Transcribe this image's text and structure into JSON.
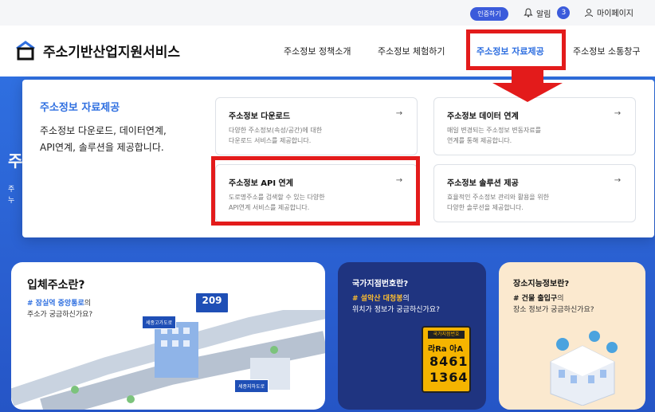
{
  "topbar": {
    "cert_label": "인증하기",
    "alarm_label": "알림",
    "alarm_count": "3",
    "mypage_label": "마이페이지"
  },
  "header": {
    "logo_title": "주소기반산업지원서비스",
    "nav": [
      {
        "label": "주소정보 정책소개"
      },
      {
        "label": "주소정보 체험하기"
      },
      {
        "label": "주소정보 자료제공"
      },
      {
        "label": "주소정보 소통창구"
      }
    ]
  },
  "hero": {
    "side_char": "주",
    "side_line1": "주",
    "side_line2": "누"
  },
  "panel": {
    "title": "주소정보 자료제공",
    "desc_line1": "주소정보 다운로드, 데이터연계,",
    "desc_line2": "API연계, 솔루션을 제공합니다.",
    "cards": [
      {
        "title": "주소정보 다운로드",
        "line1": "다양한 주소정보(속성/공간)에 대한",
        "line2": "다운로드 서비스를 제공합니다."
      },
      {
        "title": "주소정보 데이터 연계",
        "line1": "매일 변경되는 주소정보 변동자료를",
        "line2": "연계를 통해 제공합니다."
      },
      {
        "title": "주소정보 API 연계",
        "line1": "도로명주소를 검색할 수 있는 다양한",
        "line2": "API연계 서비스를 제공합니다."
      },
      {
        "title": "주소정보 솔루션 제공",
        "line1": "효율적인 주소정보 관리와 활용을 위한",
        "line2": "다양한 솔루션을 제공합니다."
      }
    ],
    "arrow_glyph": "→"
  },
  "bottom": {
    "card1": {
      "title": "입체주소란?",
      "tag": "# 잠실역 중앙통로",
      "tag_suffix": "의",
      "sub": "주소가 궁금하신가요?",
      "sign_209": "209",
      "sign_a": "세종고가도로",
      "sign_b": "세종지하도로"
    },
    "card2": {
      "title": "국가지점번호란?",
      "tag": "# 설악산 대청봉",
      "tag_suffix": "의",
      "sub": "위치가 정보가 궁금하신가요?",
      "plate_top": "국가지점번호",
      "plate_mid": "라Ra 아A",
      "plate_n1": "8461",
      "plate_n2": "1364"
    },
    "card3": {
      "title": "장소지능정보란?",
      "tag": "# 건물 출입구",
      "tag_suffix": "의",
      "sub": "장소 정보가 궁금하신가요?"
    }
  },
  "colors": {
    "accent": "#2f6fe0",
    "highlight": "#e31b1b",
    "hero": "#2f6fe0",
    "dark_card": "#1f3480",
    "light_card": "#fbe9cf"
  }
}
